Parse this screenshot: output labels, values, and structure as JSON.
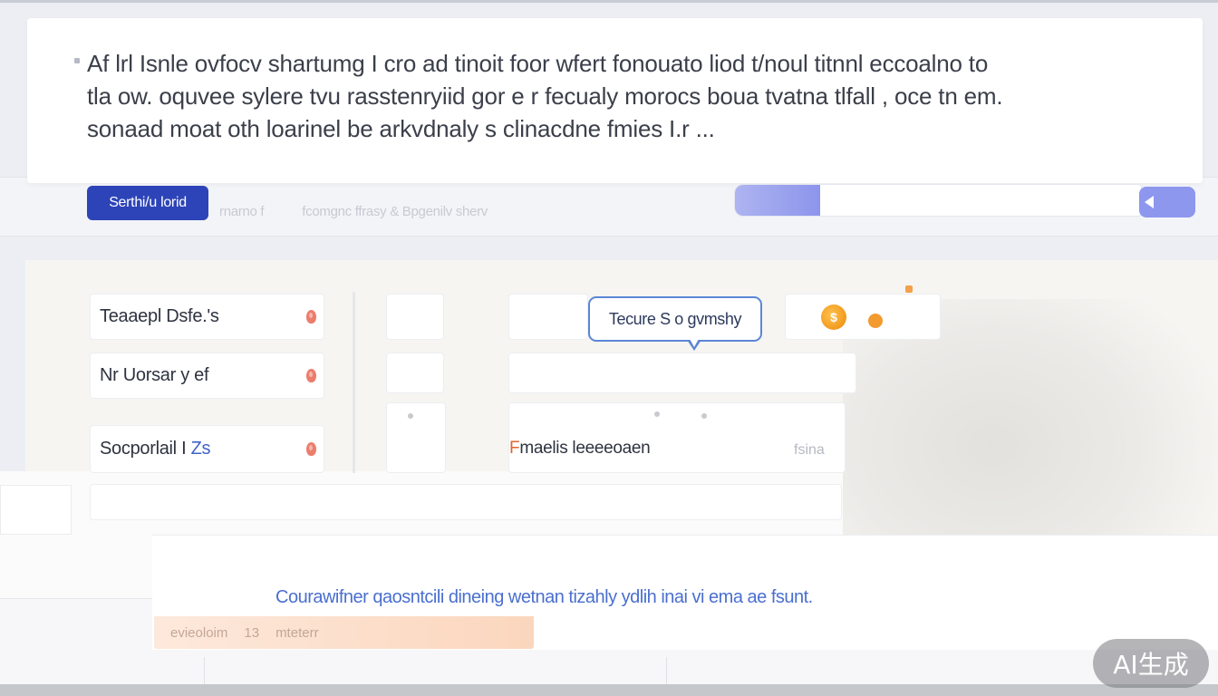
{
  "message": {
    "lines": [
      "Af lrl Isnle ovfocv shartumg I cro ad tinoit foor wfert fonouato liod t/noul titnnl eccoalno to",
      "tla ow.  oquvee sylere tvu rasstenryiid gor e r fecualy morocs boua tvatna tlfall , oce tn em.",
      "sonaad  moat oth loarinel be arkvdnaly s clinacdne fmies I.r ..."
    ]
  },
  "toolbar": {
    "primary_button": "Serthi/u lorid",
    "hint_left": "rnarno f",
    "hint_right": "fcomgnc ffrasy & Bpgenilv  sherv"
  },
  "progress": {
    "percent": 21
  },
  "list": {
    "items": [
      {
        "label": "Teaaepl Dsfe.'s",
        "icon": "drop-icon"
      },
      {
        "label": "Nr  Uorsar  y ef",
        "icon": "drop-icon"
      },
      {
        "label": "Socporlail I",
        "accent": "Zs",
        "icon": "drop-icon"
      }
    ]
  },
  "tooltip": {
    "text": "Tecure S o gvmshy"
  },
  "coin": {
    "symbol": "$"
  },
  "field": {
    "first": "F",
    "rest": "maelis  leeeeoaen",
    "suffix": "fsina"
  },
  "info": {
    "text": "Courawifner qaosntcili dineing wetnan tizahly  ydlih  inai vi ema ae fsunt."
  },
  "status": {
    "items": [
      "evieoloim",
      "13",
      "mteterr"
    ]
  },
  "badge": {
    "text": "AI生成"
  },
  "colors": {
    "primary": "#2d44b8",
    "progress": "#8d97ee",
    "tooltip_border": "#5b86d6",
    "accent_text": "#4a6fcf",
    "warning": "#ec7d6c",
    "orange": "#f39a30"
  }
}
